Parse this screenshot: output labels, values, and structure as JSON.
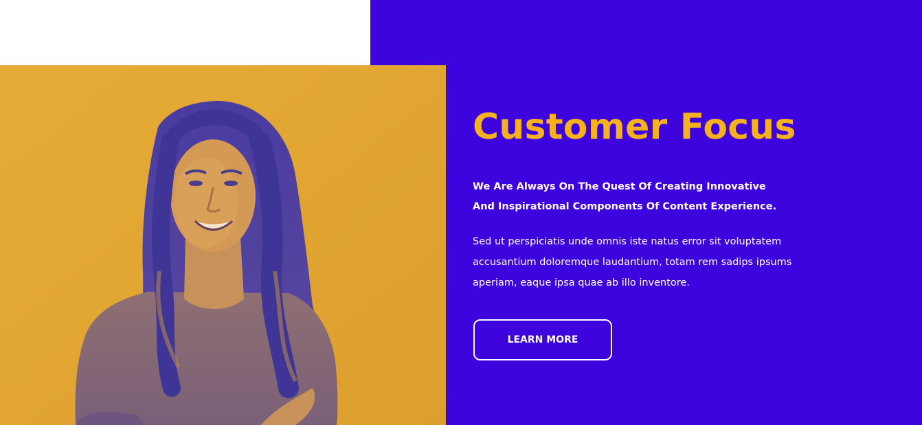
{
  "section": {
    "title": "Customer Focus",
    "lead": "We Are Always On The Quest Of Creating Innovative And Inspirational Components Of Content Experience.",
    "body": "Sed ut perspiciatis unde omnis iste natus error sit voluptatem accusantium doloremque laudantium, totam rem sadips ipsums aperiam, eaque ipsa quae ab illo inventore.",
    "button_label": "LEARN MORE"
  },
  "colors": {
    "panel_background": "#3d04de",
    "photo_background": "#e3a631",
    "title_color": "#f5b21e",
    "text_color": "#ffffff"
  },
  "image": {
    "icon": "woman-portrait-duotone"
  }
}
